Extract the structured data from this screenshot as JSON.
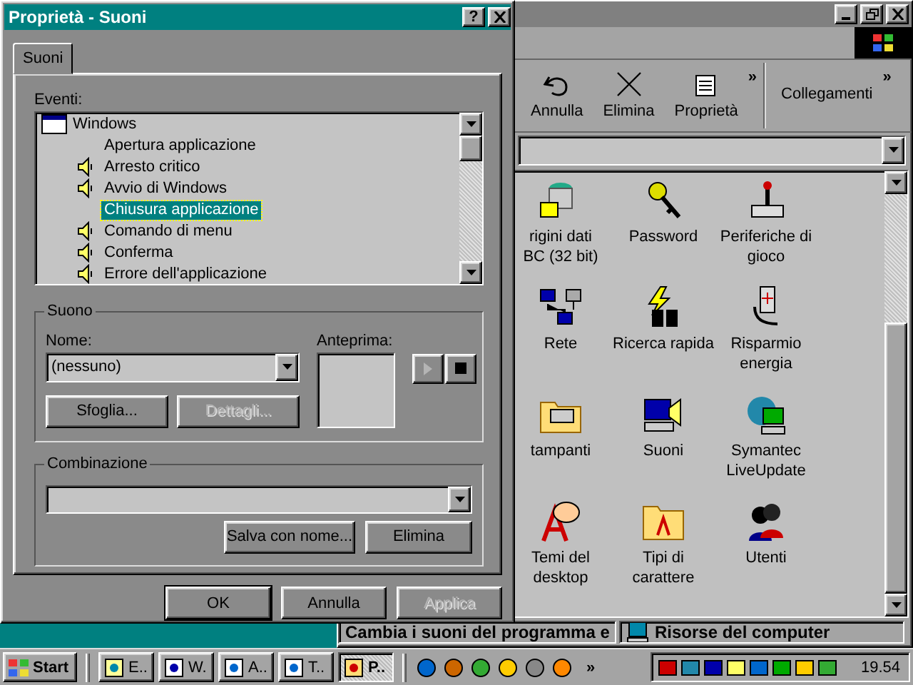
{
  "explorer": {
    "toolbar": [
      {
        "label": "Annulla"
      },
      {
        "label": "Elimina"
      },
      {
        "label": "Proprietà"
      }
    ],
    "more_glyph": "»",
    "links_label": "Collegamenti",
    "links_more_glyph": "»",
    "items": [
      {
        "label": "rigini dati\nBC (32 bit)"
      },
      {
        "label": "Password"
      },
      {
        "label": "Periferiche di\ngioco"
      },
      {
        "label": "Rete"
      },
      {
        "label": "Ricerca rapida"
      },
      {
        "label": "Risparmio\nenergia"
      },
      {
        "label": "tampanti"
      },
      {
        "label": "Suoni"
      },
      {
        "label": "Symantec\nLiveUpdate"
      },
      {
        "label": "Temi del\ndesktop"
      },
      {
        "label": "Tipi di\ncarattere"
      },
      {
        "label": "Utenti"
      }
    ],
    "status_bar": [
      {
        "text": "Cambia i suoni del programma e"
      },
      {
        "text": "Risorse del computer"
      }
    ]
  },
  "dialog": {
    "title": "Proprietà - Suoni",
    "help_button": "?",
    "tabs": [
      {
        "label": "Suoni",
        "selected": true
      }
    ],
    "events_label": "Eventi:",
    "events": [
      {
        "label": "Windows",
        "selected": false,
        "children": [
          {
            "label": "Apertura applicazione",
            "sound": false,
            "selected": false
          },
          {
            "label": "Arresto critico",
            "sound": true,
            "selected": false
          },
          {
            "label": "Avvio di Windows",
            "sound": true,
            "selected": false
          },
          {
            "label": "Chiusura applicazione",
            "sound": false,
            "selected": true
          },
          {
            "label": "Comando di menu",
            "sound": true,
            "selected": false
          },
          {
            "label": "Conferma",
            "sound": true,
            "selected": false
          },
          {
            "label": "Errore dell'applicazione",
            "sound": true,
            "selected": false
          }
        ]
      }
    ],
    "sound_group": {
      "title": "Suono",
      "name_label": "Nome:",
      "name_value": "(nessuno)",
      "browse_button": {
        "label": "Sfoglia...",
        "disabled": false
      },
      "details_button": {
        "label": "Dettagli...",
        "disabled": true
      },
      "preview_label": "Anteprima:",
      "play_button": {
        "disabled": true
      },
      "stop_button": {
        "disabled": false
      }
    },
    "scheme_group": {
      "title": "Combinazione",
      "save_button": {
        "label": "Salva con nome...",
        "disabled": false
      },
      "delete_button": {
        "label": "Elimina",
        "disabled": false
      }
    },
    "buttons": [
      {
        "label": "OK",
        "default": true,
        "disabled": false
      },
      {
        "label": "Annulla",
        "default": false,
        "disabled": false
      },
      {
        "label": "Applica",
        "default": false,
        "disabled": true
      }
    ]
  },
  "taskbar": {
    "start": "Start",
    "tasks": [
      {
        "label": "E..",
        "selected": false
      },
      {
        "label": "W.",
        "selected": false
      },
      {
        "label": "A..",
        "selected": false
      },
      {
        "label": "T..",
        "selected": false
      },
      {
        "label": "P..",
        "selected": true
      }
    ],
    "more_glyph": "»",
    "clock": "19.54"
  }
}
